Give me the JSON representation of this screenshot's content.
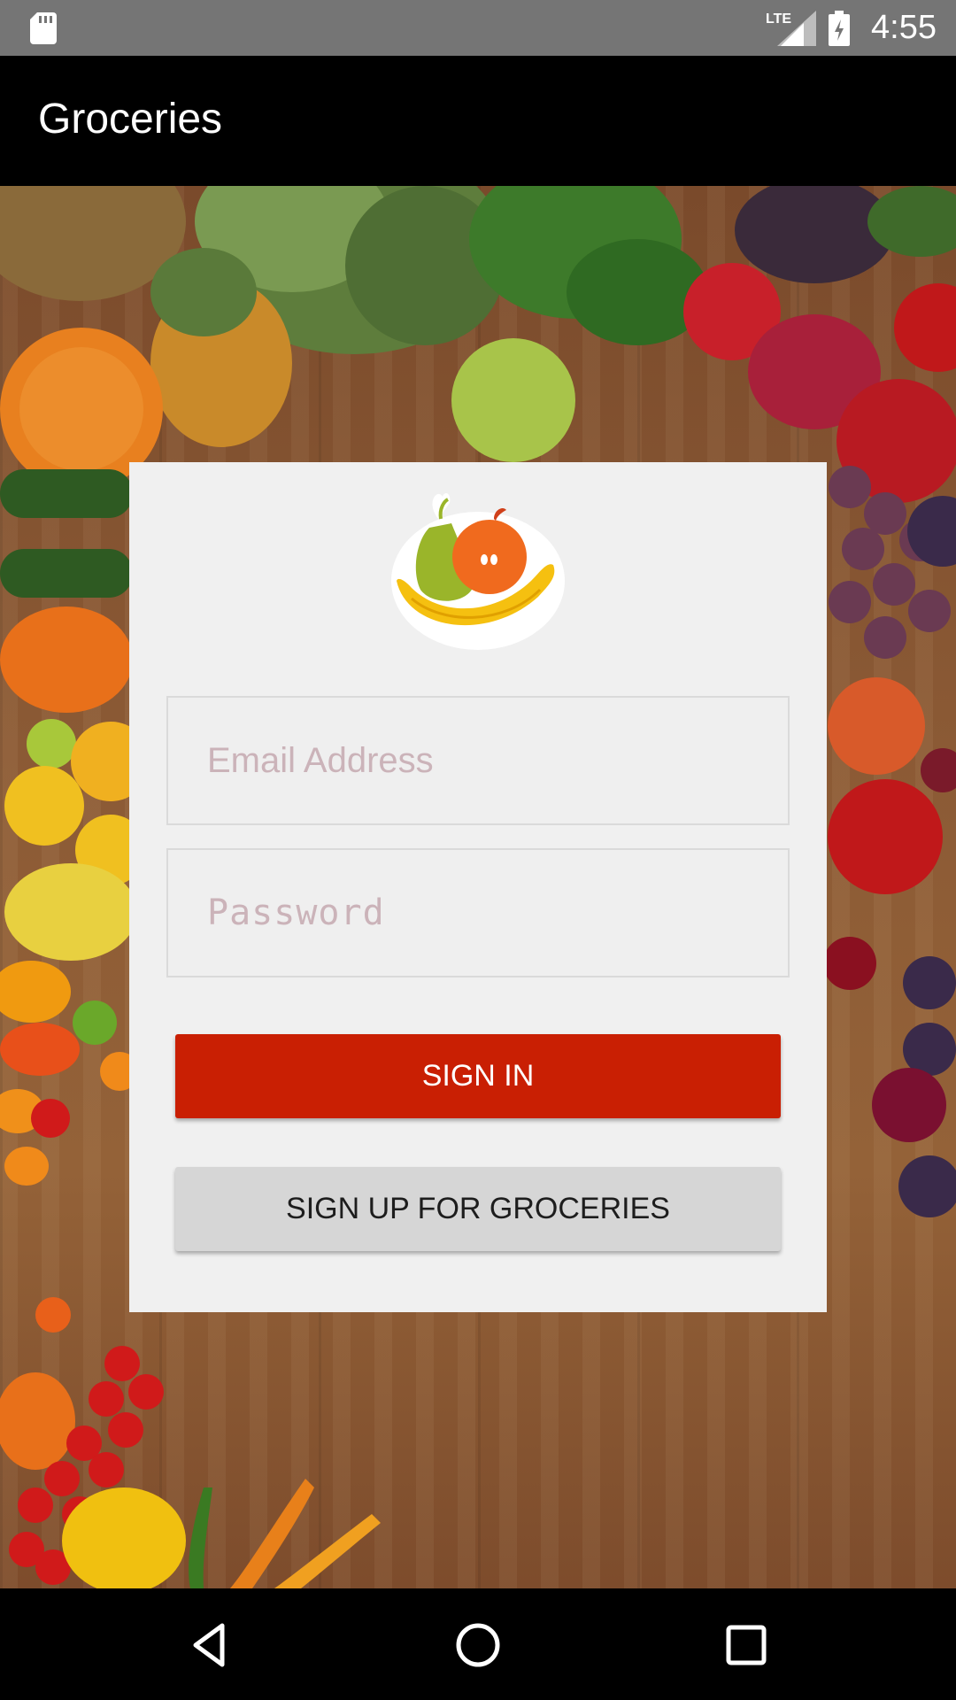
{
  "status_bar": {
    "network": "LTE",
    "time": "4:55"
  },
  "app_bar": {
    "title": "Groceries"
  },
  "login_card": {
    "email": {
      "placeholder": "Email Address",
      "value": ""
    },
    "password": {
      "placeholder": "Password",
      "value": ""
    },
    "sign_in_label": "SIGN IN",
    "sign_up_label": "SIGN UP FOR GROCERIES"
  },
  "colors": {
    "primary_button": "#c91f03",
    "secondary_button": "#d6d6d6",
    "card_background": "#f0f0f0",
    "app_bar": "#000000",
    "placeholder_text": "#cbb3b9"
  },
  "icons": [
    "sd-card-icon",
    "signal-icon",
    "battery-charging-icon",
    "fruit-logo-icon",
    "back-icon",
    "home-icon",
    "recents-icon"
  ]
}
